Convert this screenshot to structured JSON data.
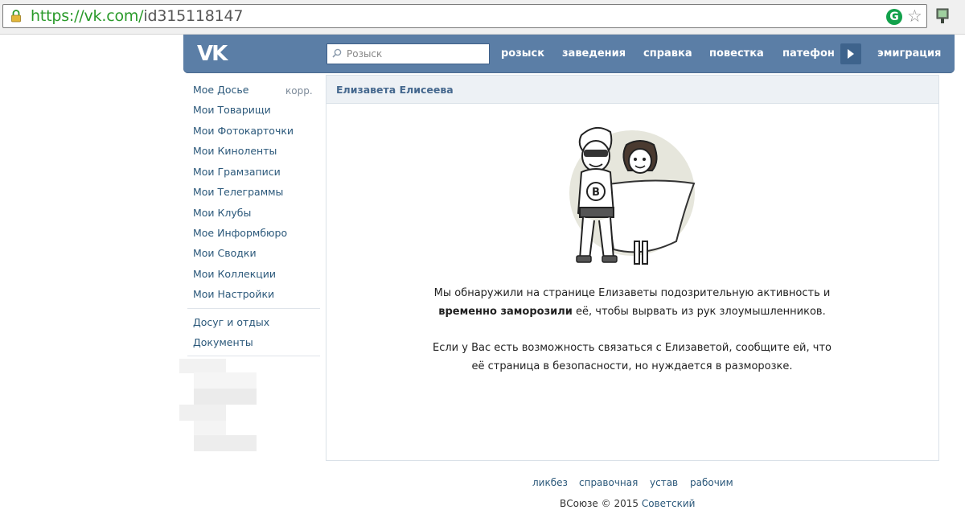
{
  "browser": {
    "url_scheme_host": "https://vk.com/",
    "url_path": "id315118147"
  },
  "header": {
    "logo": "VK",
    "search_placeholder": "Розыск",
    "nav": [
      "розыск",
      "заведения",
      "справка",
      "повестка",
      "патефон",
      "эмиграция"
    ]
  },
  "sidebar": {
    "items": [
      "Мое Досье",
      "Мои Товарищи",
      "Мои Фотокарточки",
      "Мои Киноленты",
      "Мои Грамзаписи",
      "Мои Телеграммы",
      "Мои Клубы",
      "Мое Информбюро",
      "Мои Сводки",
      "Мои Коллекции",
      "Мои Настройки"
    ],
    "edit_label": "корр.",
    "extra_items": [
      "Досуг и отдых",
      "Документы"
    ]
  },
  "profile": {
    "name": "Елизавета Елисеева",
    "message_part1": "Мы обнаружили на странице Елизаветы подозрительную активность и",
    "message_bold": "временно заморозили",
    "message_part2": " её, чтобы вырвать из рук злоумышленников.",
    "contact_line1": "Если у Вас есть возможность связаться с Елизаветой, сообщите ей, что",
    "contact_line2": "её страница в безопасности, но нуждается в разморозке."
  },
  "footer": {
    "links": [
      "ликбез",
      "справочная",
      "устав",
      "рабочим"
    ],
    "copyright": "ВСоюзе © 2015",
    "language": "Советский"
  },
  "colors": {
    "header_bg": "#5b7ea6",
    "link": "#2b587a",
    "panel_header_bg": "#edf1f5",
    "url_green": "#2a9a2a"
  }
}
